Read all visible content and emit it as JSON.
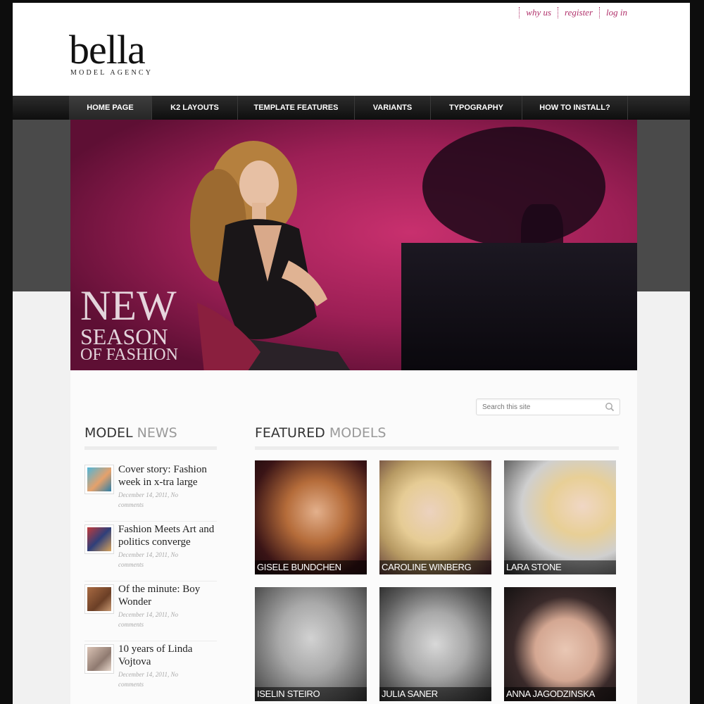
{
  "top_links": [
    "why us",
    "register",
    "log in"
  ],
  "logo": {
    "main": "bella",
    "sub": "MODEL AGENCY"
  },
  "nav": [
    {
      "label": "HOME PAGE",
      "active": true
    },
    {
      "label": "K2 LAYOUTS",
      "active": false
    },
    {
      "label": "TEMPLATE FEATURES",
      "active": false
    },
    {
      "label": "VARIANTS",
      "active": false
    },
    {
      "label": "TYPOGRAPHY",
      "active": false
    },
    {
      "label": "HOW TO INSTALL?",
      "active": false
    }
  ],
  "hero": {
    "line1": "NEW",
    "line2": "SEASON",
    "line3": "OF FASHION"
  },
  "search": {
    "placeholder": "Search this site",
    "icon": "search-icon"
  },
  "news": {
    "title_dark": "MODEL",
    "title_light": "NEWS",
    "items": [
      {
        "title": "Cover story: Fashion week in x-tra large",
        "date": "December 14, 2011, No",
        "comments": "comments"
      },
      {
        "title": "Fashion Meets Art and politics converge",
        "date": "December 14, 2011, No",
        "comments": "comments"
      },
      {
        "title": "Of the minute: Boy Wonder",
        "date": "December 14, 2011, No",
        "comments": "comments"
      },
      {
        "title": "10 years of Linda Vojtova",
        "date": "December 14, 2011, No",
        "comments": "comments"
      }
    ]
  },
  "featured": {
    "title_dark": "FEATURED",
    "title_light": "MODELS",
    "models": [
      {
        "name": "GISELE BUNDCHEN"
      },
      {
        "name": "CAROLINE WINBERG"
      },
      {
        "name": "LARA STONE"
      },
      {
        "name": "ISELIN STEIRO"
      },
      {
        "name": "JULIA SANER"
      },
      {
        "name": "ANNA JAGODZINSKA"
      }
    ]
  },
  "colors": {
    "accent": "#b0306a",
    "nav_bg": "#1a1a1a",
    "hero_magenta": "#a8245d"
  }
}
